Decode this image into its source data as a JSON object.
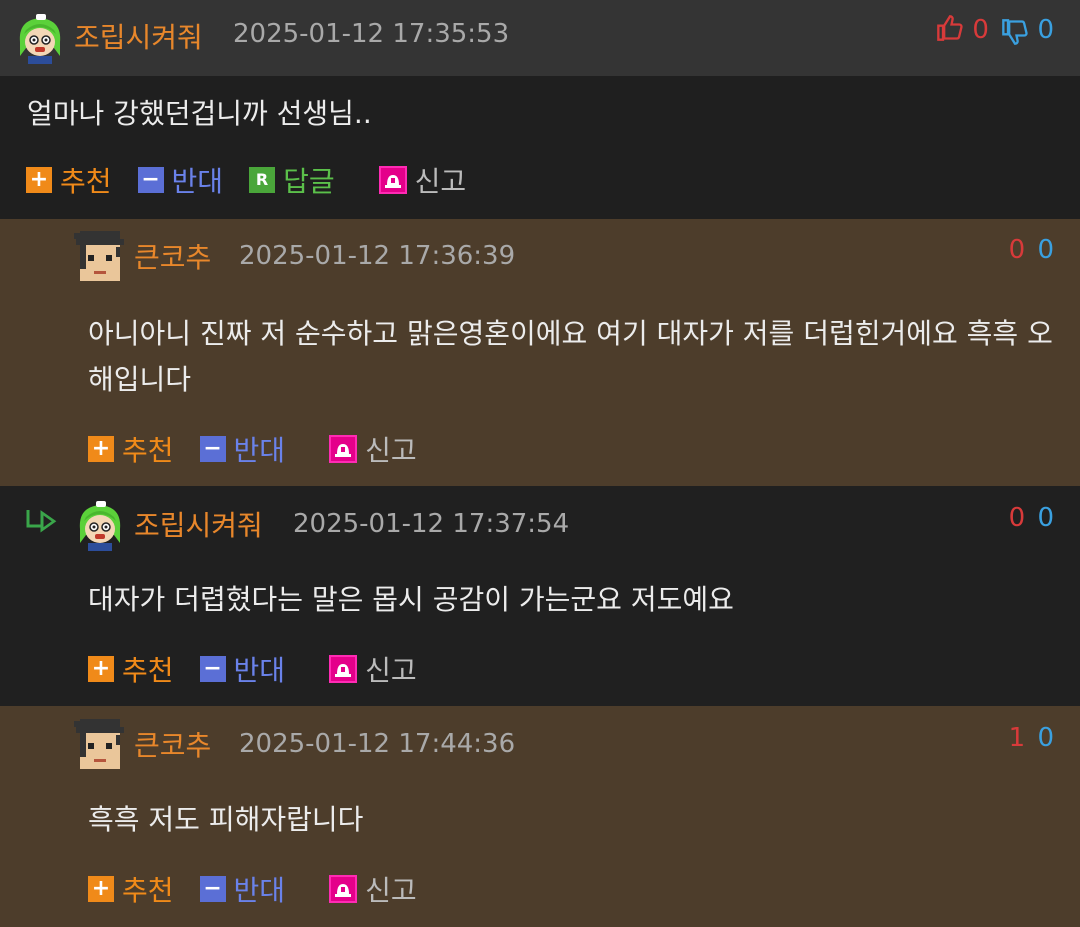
{
  "comments": [
    {
      "nickname": "조립시켜줘",
      "timestamp": "2025-01-12 17:35:53",
      "up": "0",
      "down": "0",
      "text": "얼마나 강했던겁니까 선생님..",
      "actions": {
        "recommend": "추천",
        "oppose": "반대",
        "reply": "답글",
        "report": "신고"
      }
    },
    {
      "nickname": "큰코추",
      "timestamp": "2025-01-12 17:36:39",
      "up": "0",
      "down": "0",
      "text": "아니아니 진짜 저 순수하고 맑은영혼이에요 여기 대자가 저를 더럽힌거에요 흑흑 오해입니다",
      "actions": {
        "recommend": "추천",
        "oppose": "반대",
        "report": "신고"
      }
    },
    {
      "nickname": "조립시켜줘",
      "timestamp": "2025-01-12 17:37:54",
      "up": "0",
      "down": "0",
      "text": "대자가 더렵혔다는 말은 몹시 공감이 가는군요 저도예요",
      "actions": {
        "recommend": "추천",
        "oppose": "반대",
        "report": "신고"
      }
    },
    {
      "nickname": "큰코추",
      "timestamp": "2025-01-12 17:44:36",
      "up": "1",
      "down": "0",
      "text": "흑흑 저도 피해자랍니다",
      "actions": {
        "recommend": "추천",
        "oppose": "반대",
        "report": "신고"
      }
    }
  ],
  "icons": {
    "thumbs_up": "thumbs-up-icon",
    "thumbs_down": "thumbs-down-icon",
    "reply_arrow": "reply-arrow-icon"
  },
  "colors": {
    "nickname": "#e8872b",
    "upvote": "#d83a3a",
    "downvote": "#3aa0e0",
    "recommend": "#f08a19",
    "oppose": "#5b6fd6",
    "reply": "#4aa63a",
    "report": "#e4008a",
    "reply_bg": "#4d3d2b"
  }
}
